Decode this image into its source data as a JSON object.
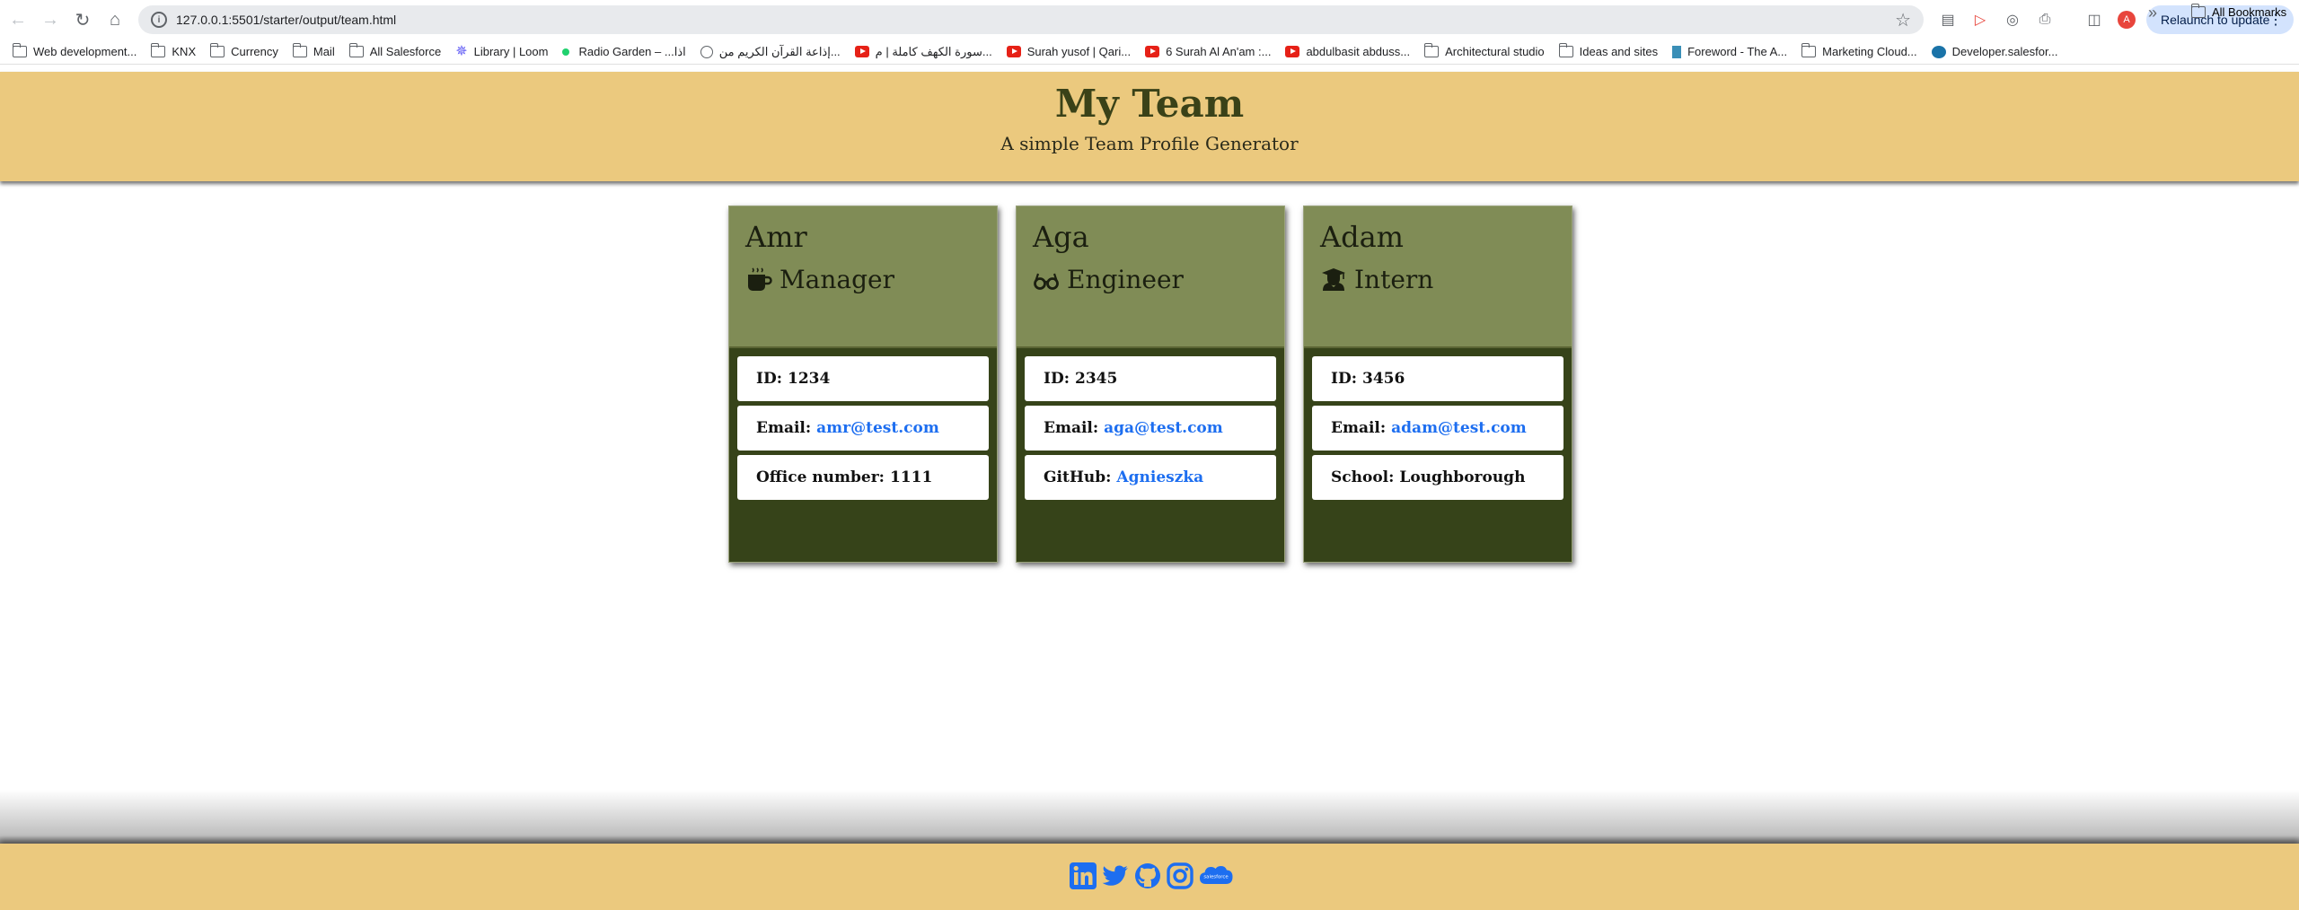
{
  "browser": {
    "url": "127.0.0.1:5501/starter/output/team.html",
    "relaunch_label": "Relaunch to update",
    "profile_initial": "A"
  },
  "bookmarks": [
    {
      "label": "Web development...",
      "icon": "folder-icon"
    },
    {
      "label": "KNX",
      "icon": "folder-icon"
    },
    {
      "label": "Currency",
      "icon": "folder-icon"
    },
    {
      "label": "Mail",
      "icon": "folder-icon"
    },
    {
      "label": "All Salesforce",
      "icon": "folder-icon"
    },
    {
      "label": "Library | Loom",
      "icon": "loom-icon"
    },
    {
      "label": "Radio Garden – ...اذا",
      "icon": "radio-dot-icon"
    },
    {
      "label": "إذاعة القرآن الكريم من...",
      "icon": "globe-icon"
    },
    {
      "label": "سورة الكهف كاملة | م...",
      "icon": "youtube-icon"
    },
    {
      "label": "Surah yusof | Qari...",
      "icon": "youtube-icon"
    },
    {
      "label": "6 Surah Al An'am :...",
      "icon": "youtube-icon"
    },
    {
      "label": "abdulbasit abduss...",
      "icon": "youtube-icon"
    },
    {
      "label": "Architectural studio",
      "icon": "folder-icon"
    },
    {
      "label": "Ideas and sites",
      "icon": "folder-icon"
    },
    {
      "label": "Foreword - The A...",
      "icon": "document-icon"
    },
    {
      "label": "Marketing Cloud...",
      "icon": "folder-icon"
    },
    {
      "label": "Developer.salesfor...",
      "icon": "cloud-icon"
    }
  ],
  "all_bookmarks_label": "All Bookmarks",
  "header": {
    "title": "My Team",
    "subtitle": "A simple Team Profile Generator"
  },
  "colors": {
    "header_bg": "#ebc97e",
    "card_head_bg": "#808c56",
    "card_body_bg": "#364319",
    "link": "#1d6ef0"
  },
  "team": [
    {
      "name": "Amr",
      "role": "Manager",
      "role_icon": "mug-icon",
      "id_label": "ID:",
      "id": "1234",
      "email_label": "Email:",
      "email": "amr@test.com",
      "extra_label": "Office number:",
      "extra": "1111"
    },
    {
      "name": "Aga",
      "role": "Engineer",
      "role_icon": "glasses-icon",
      "id_label": "ID:",
      "id": "2345",
      "email_label": "Email:",
      "email": "aga@test.com",
      "extra_label": "GitHub:",
      "extra": "Agnieszka"
    },
    {
      "name": "Adam",
      "role": "Intern",
      "role_icon": "graduate-icon",
      "id_label": "ID:",
      "id": "3456",
      "email_label": "Email:",
      "email": "adam@test.com",
      "extra_label": "School:",
      "extra": "Loughborough"
    }
  ],
  "footer": {
    "social": [
      "linkedin-icon",
      "twitter-icon",
      "github-icon",
      "instagram-icon",
      "salesforce-icon"
    ],
    "salesforce_text": "salesforce"
  }
}
